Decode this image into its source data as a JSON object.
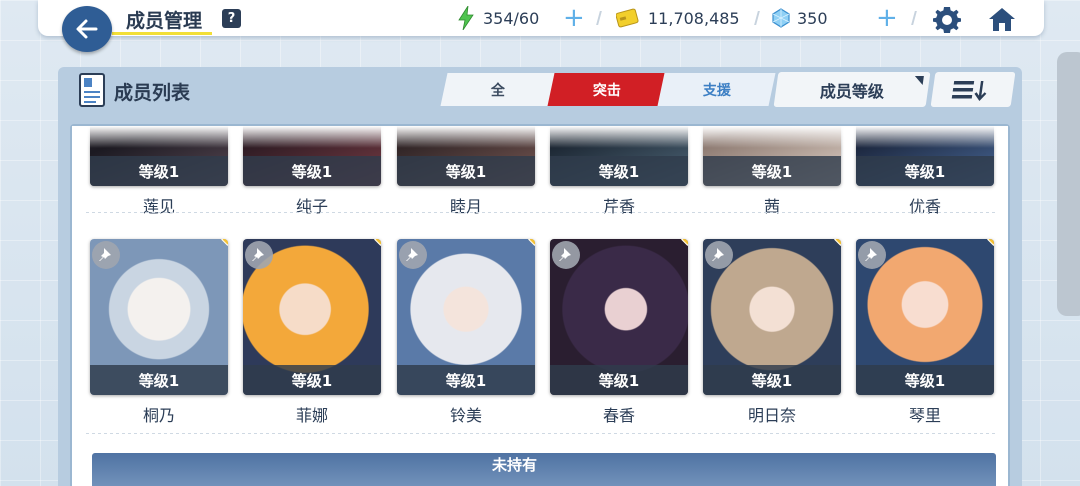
{
  "header": {
    "title": "成员管理",
    "help_label": "?",
    "ap": "354/60",
    "credits": "11,708,485",
    "gems": "350"
  },
  "panel": {
    "title": "成员列表",
    "tabs": [
      "全",
      "突击",
      "支援"
    ],
    "active_tab": "突击",
    "sort_label": "成员等级"
  },
  "students_top": [
    {
      "name": "莲见",
      "level": "等级1"
    },
    {
      "name": "纯子",
      "level": "等级1"
    },
    {
      "name": "睦月",
      "level": "等级1"
    },
    {
      "name": "芹香",
      "level": "等级1"
    },
    {
      "name": "茜",
      "level": "等级1"
    },
    {
      "name": "优香",
      "level": "等级1"
    }
  ],
  "students": [
    {
      "name": "桐乃",
      "level": "等级1"
    },
    {
      "name": "菲娜",
      "level": "等级1"
    },
    {
      "name": "铃美",
      "level": "等级1"
    },
    {
      "name": "春香",
      "level": "等级1"
    },
    {
      "name": "明日奈",
      "level": "等级1"
    },
    {
      "name": "琴里",
      "level": "等级1"
    }
  ],
  "bottom_partial_text": "未持有",
  "colors": {
    "accent_red": "#d11f25",
    "support_blue": "#3c7fc4",
    "nav_dark": "#2f5d95",
    "ap_green": "#4fc44f",
    "gold": "#f6c234"
  },
  "icons": [
    "back-arrow-icon",
    "ap-bolt-icon",
    "credit-card-icon",
    "gem-icon",
    "gear-icon",
    "home-icon",
    "pin-icon",
    "sort-order-icon"
  ]
}
